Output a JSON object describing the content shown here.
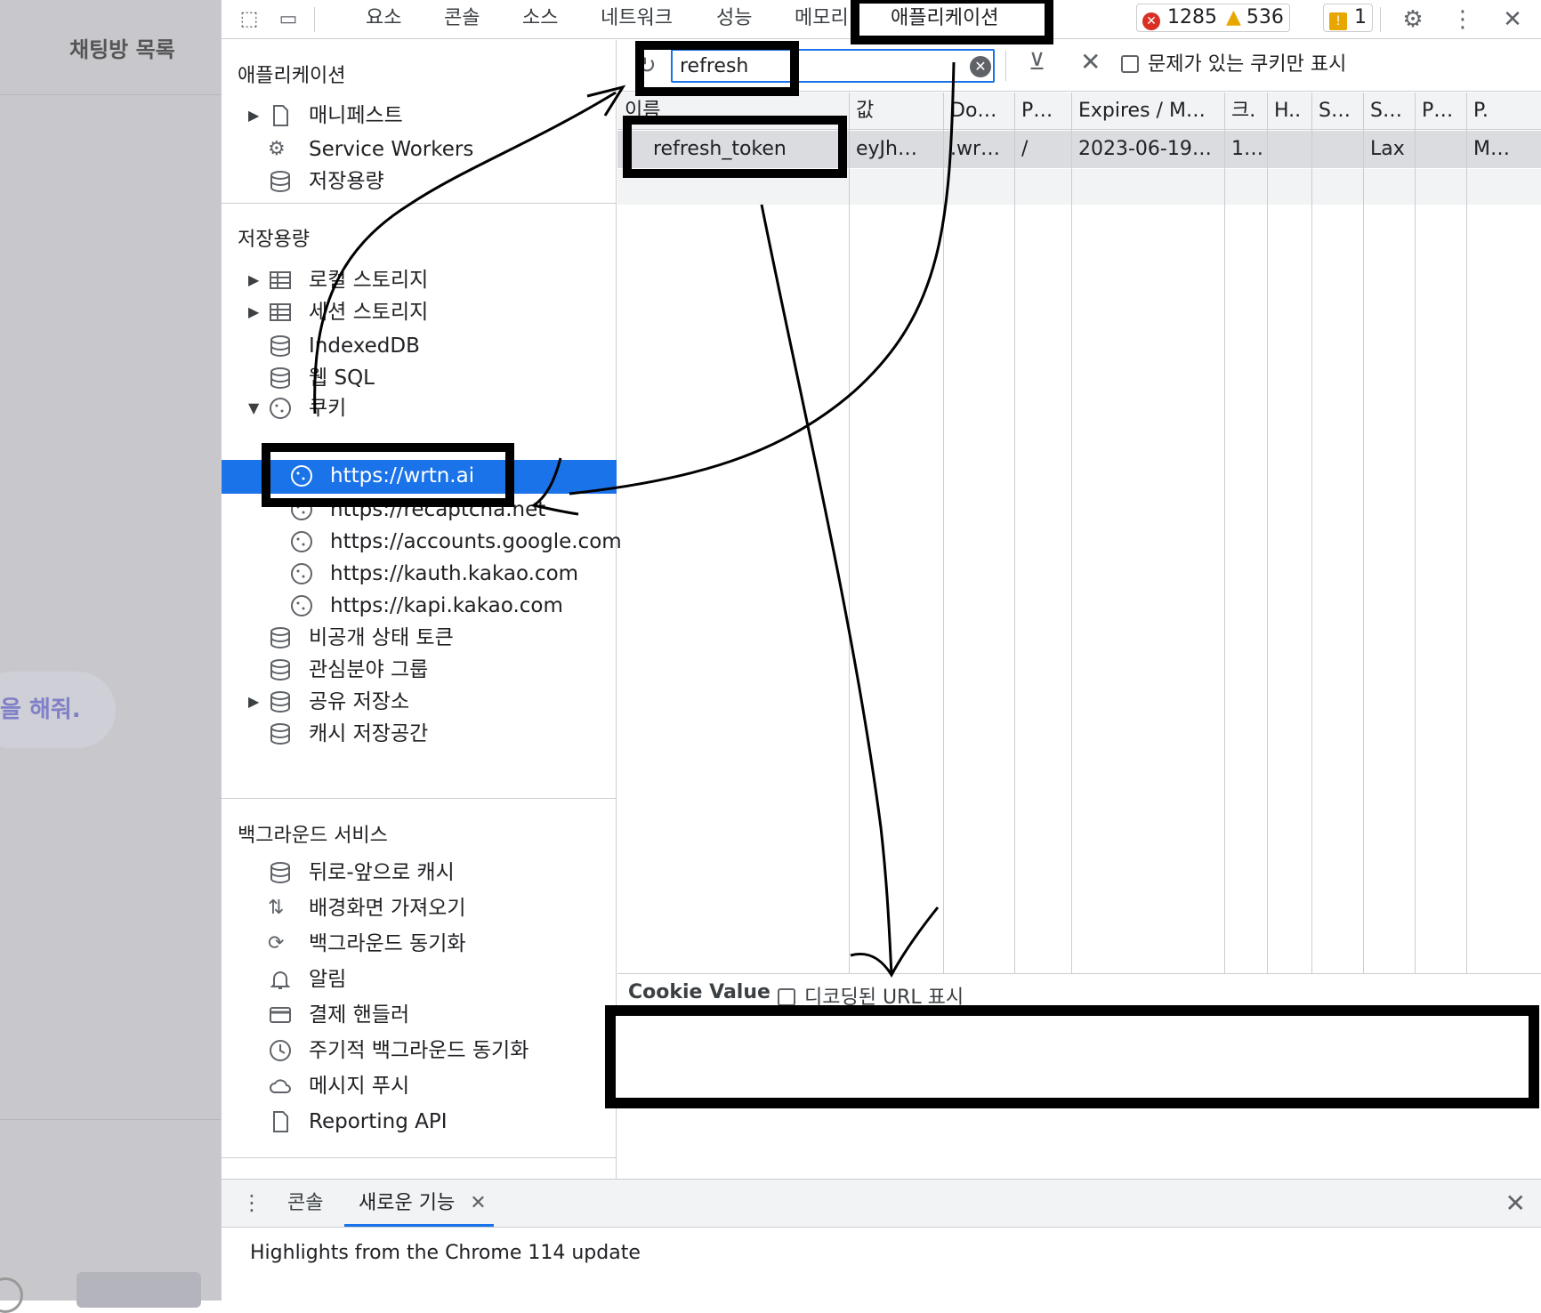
{
  "page": {
    "title": "채팅방 목록",
    "bubble_text": "을 해줘."
  },
  "toolbar": {
    "tabs": [
      "요소",
      "콘솔",
      "소스",
      "네트워크",
      "성능",
      "메모리",
      "애플리케이션"
    ],
    "errors": "1285",
    "warnings": "536",
    "issues": "1"
  },
  "sidebar": {
    "application": {
      "title": "애플리케이션",
      "items": [
        "매니페스트",
        "Service Workers",
        "저장용량"
      ]
    },
    "storage": {
      "title": "저장용량",
      "items": [
        "로컬 스토리지",
        "세션 스토리지",
        "IndexedDB",
        "웹 SQL",
        "쿠키"
      ],
      "cookies": [
        "https://wrtn.ai",
        "https://recaptcha.net",
        "https://accounts.google.com",
        "https://kauth.kakao.com",
        "https://kapi.kakao.com"
      ],
      "more": [
        "비공개 상태 토큰",
        "관심분야 그룹",
        "공유 저장소",
        "캐시 저장공간"
      ]
    },
    "background": {
      "title": "백그라운드 서비스",
      "items": [
        "뒤로-앞으로 캐시",
        "배경화면 가져오기",
        "백그라운드 동기화",
        "알림",
        "결제 핸들러",
        "주기적 백그라운드 동기화",
        "메시지 푸시",
        "Reporting API"
      ]
    }
  },
  "filter": {
    "value": "refresh",
    "only_issues_label": "문제가 있는 쿠키만 표시"
  },
  "table": {
    "headers": [
      "이름",
      "값",
      "Do…",
      "P…",
      "Expires / M…",
      "크.",
      "H..",
      "S…",
      "S…",
      "P…",
      "P."
    ],
    "rows": [
      [
        "refresh_token",
        "eyJh…",
        ".wr…",
        "/",
        "2023-06-19…",
        "1…",
        "",
        "",
        "Lax",
        "",
        "M…"
      ]
    ]
  },
  "cookie_value": {
    "title": "Cookie Value",
    "decode_label": "디코딩된 URL 표시"
  },
  "drawer": {
    "tabs": [
      "콘솔",
      "새로운 기능"
    ],
    "content": "Highlights from the Chrome 114 update"
  },
  "colors": {
    "accent": "#1a73e8",
    "error": "#d93025",
    "warning": "#e8a700",
    "annotation": "#000000"
  }
}
